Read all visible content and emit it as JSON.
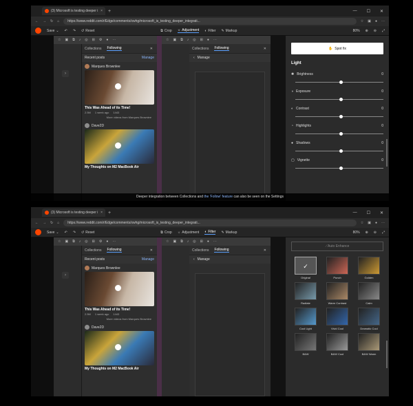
{
  "browser": {
    "tab_title": "(3) Microsoft is testing deeper i",
    "url": "https://www.reddit.com/r/Edge/comments/xwhg/microsoft_is_testing_deeper_integrati...",
    "zoom": "80%"
  },
  "editor_toolbar": {
    "save": "Save",
    "reset": "Reset",
    "crop": "Crop",
    "adjustment": "Adjustment",
    "filter": "Filter",
    "markup": "Markup",
    "zoom": "80%"
  },
  "collections": {
    "tab_collections": "Collections",
    "tab_following": "Following",
    "recent_posts": "Recent posts",
    "manage": "Manage",
    "posts": [
      {
        "author": "Marques Brownlee",
        "caption": "This Was Ahead of its Time!",
        "views": "2.5M",
        "age": "1 week ago",
        "count": "1443"
      },
      {
        "author": "Dave2D",
        "caption": "My Thoughts on M2 MacBook Air"
      }
    ],
    "more": "More videos from Marques Brownlee"
  },
  "adjust_panel": {
    "spot_fix": "Spot fix",
    "light": "Light",
    "sliders": [
      {
        "label": "Brightness",
        "value": "0",
        "pos": 0.5,
        "icon": "sun-icon"
      },
      {
        "label": "Exposure",
        "value": "0",
        "pos": 0.5,
        "icon": "exposure-icon"
      },
      {
        "label": "Contrast",
        "value": "0",
        "pos": 0.5,
        "icon": "contrast-icon"
      },
      {
        "label": "Highlights",
        "value": "0",
        "pos": 0.5,
        "icon": "highlights-icon"
      },
      {
        "label": "Shadows",
        "value": "0",
        "pos": 0.5,
        "icon": "shadows-icon"
      },
      {
        "label": "Vignette",
        "value": "0",
        "pos": 0.5,
        "icon": "vignette-icon"
      }
    ]
  },
  "caption": {
    "before": "Deeper integration between Collections and",
    "highlight": "the 'Follow' feature",
    "after": "can also be seen on the Settings"
  },
  "filter_panel": {
    "auto_enhance": "Auto Enhance",
    "filters": [
      "Original",
      "Punch",
      "Golden",
      "Radiate",
      "Warm Contrast",
      "Calm",
      "Cool Light",
      "Vivid Cool",
      "Dramatic Cool",
      "B&W",
      "B&W Cool",
      "B&W Warm"
    ]
  }
}
